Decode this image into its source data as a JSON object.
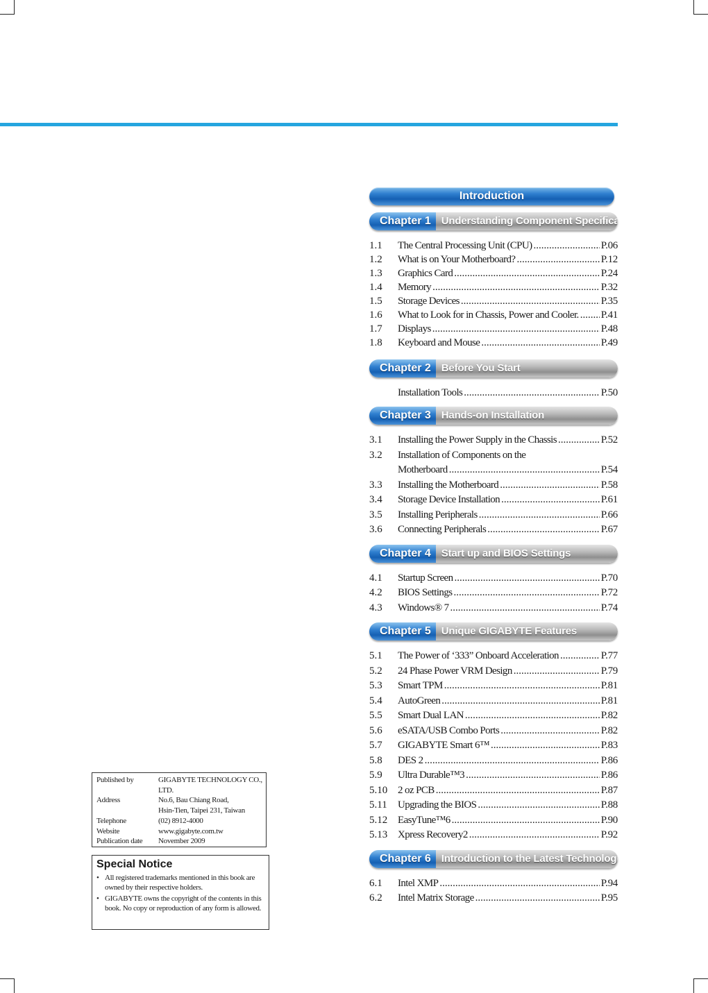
{
  "toc": {
    "intro_label": "Introduction",
    "chapters": [
      {
        "num_label": "Chapter 1",
        "title": "Understanding Component Specifications",
        "items": [
          {
            "num": "1.1",
            "label": "The Central Processing Unit (CPU)",
            "page": "P.06"
          },
          {
            "num": "1.2",
            "label": "What is on Your Motherboard?",
            "page": "P.12"
          },
          {
            "num": "1.3",
            "label": "Graphics Card",
            "page": "P.24"
          },
          {
            "num": "1.4",
            "label": "Memory",
            "page": "P.32"
          },
          {
            "num": "1.5",
            "label": "Storage Devices",
            "page": "P.35"
          },
          {
            "num": "1.6",
            "label": "What to Look for in Chassis, Power and Cooler.",
            "page": "P.41"
          },
          {
            "num": "1.7",
            "label": "Displays",
            "page": "P.48"
          },
          {
            "num": "1.8",
            "label": "Keyboard and Mouse",
            "page": "P.49"
          }
        ]
      },
      {
        "num_label": "Chapter 2",
        "title": "Before You Start",
        "items": [
          {
            "num": "",
            "label": "Installation Tools",
            "page": "P.50"
          }
        ]
      },
      {
        "num_label": "Chapter 3",
        "title": "Hands-on Installation",
        "items": [
          {
            "num": "3.1",
            "label": "Installing the Power Supply in the Chassis",
            "page": "P.52"
          },
          {
            "num": "3.2",
            "label": "Installation of Components on the",
            "page": ""
          },
          {
            "num": "",
            "label": "Motherboard",
            "page": "P.54"
          },
          {
            "num": "3.3",
            "label": "Installing the Motherboard",
            "page": "P.58"
          },
          {
            "num": "3.4",
            "label": "Storage Device Installation",
            "page": "P.61"
          },
          {
            "num": "3.5",
            "label": "Installing Peripherals",
            "page": "P.66"
          },
          {
            "num": "3.6",
            "label": "Connecting Peripherals",
            "page": "P.67"
          }
        ]
      },
      {
        "num_label": "Chapter 4",
        "title": "Start up and BIOS Settings",
        "items": [
          {
            "num": "4.1",
            "label": "Startup Screen",
            "page": "P.70"
          },
          {
            "num": "4.2",
            "label": "BIOS Settings",
            "page": "P.72"
          },
          {
            "num": "4.3",
            "label": "Windows® 7",
            "page": "P.74"
          }
        ]
      },
      {
        "num_label": "Chapter 5",
        "title": "Unique GIGABYTE Features",
        "items": [
          {
            "num": "5.1",
            "label": "The Power of ‘333” Onboard Acceleration",
            "page": "P.77"
          },
          {
            "num": "5.2",
            "label": "24 Phase Power VRM Design",
            "page": "P.79"
          },
          {
            "num": "5.3",
            "label": "Smart TPM",
            "page": "P.81"
          },
          {
            "num": "5.4",
            "label": "AutoGreen",
            "page": "P.81"
          },
          {
            "num": "5.5",
            "label": "Smart Dual LAN",
            "page": "P.82"
          },
          {
            "num": "5.6",
            "label": "eSATA/USB Combo Ports",
            "page": "P.82"
          },
          {
            "num": "5.7",
            "label": "GIGABYTE Smart 6™",
            "page": "P.83"
          },
          {
            "num": "5.8",
            "label": "DES 2",
            "page": "P.86"
          },
          {
            "num": "5.9",
            "label": "Ultra Durable™3",
            "page": "P.86"
          },
          {
            "num": "5.10",
            "label": "2 oz PCB",
            "page": "P.87"
          },
          {
            "num": "5.11",
            "label": "Upgrading the BIOS",
            "page": "P.88"
          },
          {
            "num": "5.12",
            "label": "EasyTune™6",
            "page": "P.90"
          },
          {
            "num": "5.13",
            "label": "Xpress Recovery2",
            "page": "P.92"
          }
        ]
      },
      {
        "num_label": "Chapter 6",
        "title": "Introduction to the Latest Technologies",
        "items": [
          {
            "num": "6.1",
            "label": "Intel XMP",
            "page": "P.94"
          },
          {
            "num": "6.2",
            "label": "Intel Matrix Storage",
            "page": "P.95"
          }
        ]
      }
    ]
  },
  "publisher": {
    "rows": [
      {
        "key": "Published by",
        "value": "GIGABYTE TECHNOLOGY CO.,"
      },
      {
        "key": "",
        "value": "LTD."
      },
      {
        "key": "Address",
        "value": "No.6, Bau Chiang Road,"
      },
      {
        "key": "",
        "value": "Hsin-Tien, Taipei 231, Taiwan"
      },
      {
        "key": "Telephone",
        "value": "(02) 8912-4000"
      },
      {
        "key": "Website",
        "value": "www.gigabyte.com.tw"
      },
      {
        "key": "Publication date",
        "value": "November 2009"
      }
    ]
  },
  "notice": {
    "title": "Special Notice",
    "bullet": "•",
    "items": [
      "All registered trademarks mentioned in this book are owned by their respective holders.",
      "GIGABYTE owns the copyright of the contents in this book. No copy or reproduction of any form is allowed."
    ]
  },
  "colors": {
    "accent_rule": "#25a5df",
    "chapter_blue": "#1560b3",
    "chapter_gray": "#9a9a9a"
  }
}
